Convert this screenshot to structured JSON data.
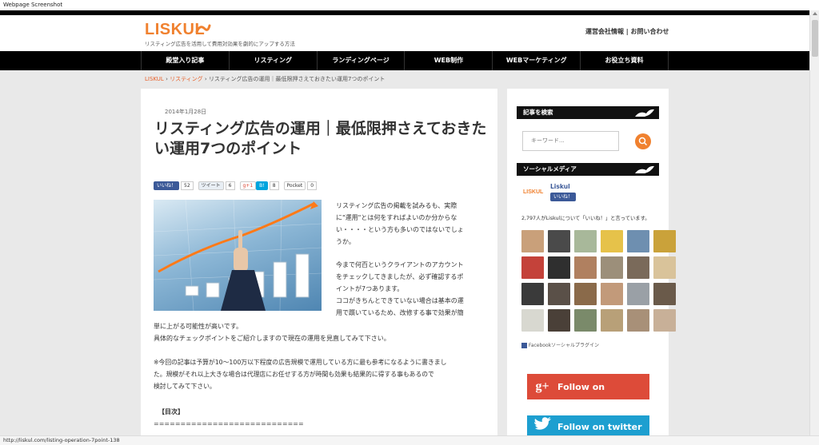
{
  "window": {
    "title": "Webpage Screenshot"
  },
  "header": {
    "logo": "LISKUL",
    "tagline": "リスティング広告を活用して費用対効果を劇的にアップする方法",
    "links": "運営会社情報 | お問い合わせ"
  },
  "nav": {
    "items": [
      {
        "label": "殿堂入り記事"
      },
      {
        "label": "リスティング"
      },
      {
        "label": "ランディングページ"
      },
      {
        "label": "WEB制作"
      },
      {
        "label": "WEBマーケティング"
      },
      {
        "label": "お役立ち資料"
      }
    ]
  },
  "breadcrumb": {
    "home": "LISKUL",
    "sep1": " › ",
    "category": "リスティング",
    "sep2": " › ",
    "current": "リスティング広告の運用｜最低限押さえておきたい運用7つのポイント"
  },
  "article": {
    "date": "2014年1月28日",
    "title": "リスティング広告の運用｜最低限押さえておきたい運用7つのポイント",
    "social": {
      "fb_label": "いいね！",
      "fb_count": "52",
      "tw_label": "ツイート",
      "tw_count": "6",
      "gp_label": "g+1",
      "hb_label": "B!",
      "hb_count": "8",
      "pk_label": "Pocket",
      "pk_count": "0"
    },
    "para1_right": [
      "リスティング広告の掲載を試みるも、実際",
      "に\"運用\"とは何をすればよいのか分からな",
      "い・・・・という方も多いのではないでしょ",
      "うか。"
    ],
    "para2_right": [
      "今まで何百というクライアントのアカウント",
      "をチェックしてきましたが、必ず確認するポ",
      "イントが7つあります。",
      "ココがきちんとできていない場合は基本の運",
      "用で躓いているため、改修する事で効果が簡"
    ],
    "para2_full": [
      "単に上がる可能性が高いです。",
      "具体的なチェックポイントをご紹介しますので現在の運用を見直してみて下さい。"
    ],
    "para3": [
      "※今回の記事は予算が10〜100万以下程度の広告規模で運用している方に最も参考になるように書きまし",
      "た。規模がそれ以上大きな場合は代理店にお任せする方が時間も効果も結果的に得する事もあるので",
      "検討してみて下さい。"
    ],
    "toc_label": "【目次】",
    "toc_divider": "============================"
  },
  "sidebar": {
    "search_head": "記事を検索",
    "search_placeholder": "キーワード...",
    "social_head": "ソーシャルメディア",
    "fb_page_name": "Liskul",
    "fb_page_logo": "LISKUL",
    "fb_like_label": "いいね！",
    "fb_fans": "2,797人がLiskulについて「いいね！」と言っています。",
    "fb_plugin": "Facebookソーシャルプラグイン",
    "gplus_button": "Follow on Google+",
    "twitter_button": "Follow on twitter"
  },
  "status": {
    "url": "http://liskul.com/listing-operation-7point-138"
  },
  "colors": {
    "brand_orange": "#f0812f",
    "nav_bg": "#000000",
    "link_orange": "#e8622c"
  }
}
